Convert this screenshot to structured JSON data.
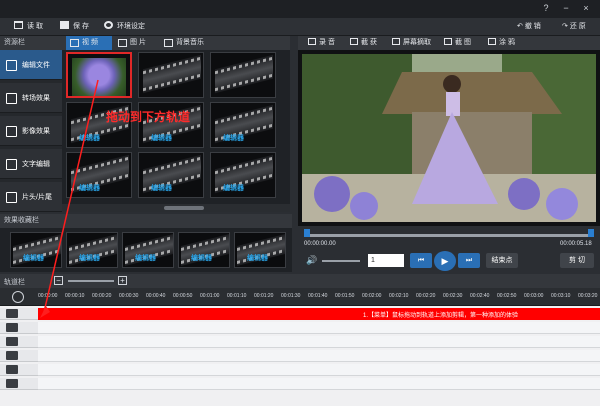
{
  "window": {
    "help": "?",
    "minimize": "−",
    "close": "×"
  },
  "toolbar": {
    "open": "读 取",
    "save": "保 存",
    "settings": "环境设定",
    "undo": "撤 销",
    "redo": "还 原"
  },
  "resource_panel": {
    "title": "资源栏",
    "items": [
      {
        "label": "编辑文件",
        "active": true
      },
      {
        "label": "转场效果",
        "active": false
      },
      {
        "label": "影像效果",
        "active": false
      },
      {
        "label": "文字编辑",
        "active": false
      },
      {
        "label": "片头/片尾",
        "active": false
      }
    ]
  },
  "media_tabs": [
    {
      "label": "视 频",
      "active": true
    },
    {
      "label": "图 片",
      "active": false
    },
    {
      "label": "背景音乐",
      "active": false
    }
  ],
  "thumbnails": {
    "watermark": "编辑器",
    "hint": "拖动到下方轨道"
  },
  "effects": {
    "title": "效果收藏栏",
    "watermark": "编辑器"
  },
  "preview_toolbar": {
    "record": "录 音",
    "capture": "截 获",
    "screen_record": "屏幕摘取",
    "screenshot": "截 图",
    "paint": "涂 鸦"
  },
  "preview": {
    "time_start": "00:00:00.00",
    "time_end": "00:00:05.18",
    "page": "1",
    "end_point": "结束点",
    "cut": "剪 切",
    "play_icon": "play-icon"
  },
  "timeline": {
    "title": "轨道栏",
    "ruler": [
      "00:00:00",
      "00:00:10",
      "00:00:20",
      "00:00:30",
      "00:00:40",
      "00:00:50",
      "00:01:00",
      "00:01:10",
      "00:01:20",
      "00:01:30",
      "00:01:40",
      "00:01:50",
      "00:02:00",
      "00:02:10",
      "00:02:20",
      "00:02:30",
      "00:02:40",
      "00:02:50",
      "00:03:00",
      "00:03:10",
      "00:03:20"
    ],
    "message": "1.【菜单】鼠标拖动到轨道上添加剪辑，第一种添加的体验"
  },
  "colors": {
    "accent": "#2a6fb5",
    "highlight": "#ff0000",
    "hint": "#ff2a2a"
  }
}
